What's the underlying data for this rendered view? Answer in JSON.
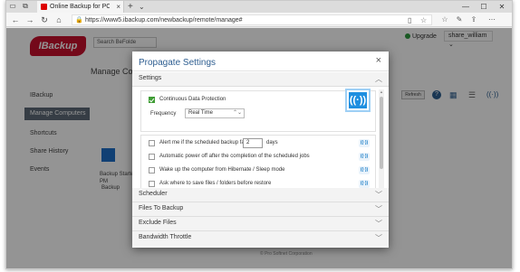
{
  "browser": {
    "tab_title": "Online Backup for PC, M",
    "url": "https://www5.ibackup.com/newbackup/remote/manage#",
    "tab_close": "×",
    "new_tab": "+",
    "tab_dropdown": "⌄",
    "ctrl_min": "—",
    "ctrl_max": "☐",
    "ctrl_close": "✕"
  },
  "site": {
    "logo_text": "IBackup",
    "search_label": "Search BeFolde",
    "upgrade": "Upgrade",
    "user": "share_william ⌄",
    "page_title": "Manage Con",
    "refresh": "Refresh",
    "footer": "© Pro Softnet Corporation"
  },
  "sidebar": {
    "items": [
      {
        "label": "IBackup"
      },
      {
        "label": "Manage Computers"
      },
      {
        "label": "Shortcuts"
      },
      {
        "label": "Share History"
      },
      {
        "label": "Events"
      }
    ]
  },
  "computer_tile": {
    "line1": "Backup Started",
    "line2": "PM",
    "backup": "Backup"
  },
  "modal": {
    "title": "Propagate Settings",
    "close": "×",
    "sections": [
      {
        "label": "Settings",
        "expanded": true
      },
      {
        "label": "Scheduler",
        "expanded": false
      },
      {
        "label": "Files To Backup",
        "expanded": false
      },
      {
        "label": "Exclude Files",
        "expanded": false
      },
      {
        "label": "Bandwidth Throttle",
        "expanded": false
      }
    ],
    "settings": {
      "cdp_label": "Continuous Data Protection",
      "cdp_checked": true,
      "frequency_label": "Frequency",
      "frequency_value": "Real Time",
      "options": [
        {
          "label": "Alert me if the scheduled backup fails for",
          "checked": false,
          "days_value": "2",
          "days_suffix": "days"
        },
        {
          "label": "Automatic power off after the completion of the scheduled jobs",
          "checked": false
        },
        {
          "label": "Wake up the computer from Hibernate / Sleep mode",
          "checked": false
        },
        {
          "label": "Ask where to save files / folders before restore",
          "checked": false
        }
      ]
    }
  },
  "colors": {
    "accent": "#2d5d90",
    "brand": "#c8102e",
    "propagate": "#1f8fe0",
    "checked": "#3f9d35"
  }
}
